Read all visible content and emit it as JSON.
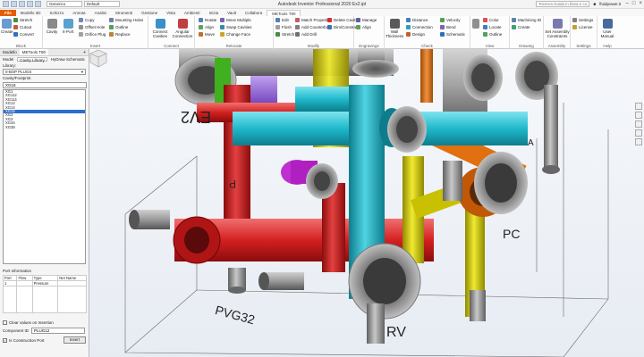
{
  "titlebar": {
    "app_title": "Autodesk Inventor Professional 2020   Ex2.ipt",
    "material": "Generico",
    "appearance": "Default",
    "search_placeholder": "Ricerca Guida in linea e comandi",
    "user": "lfuidpower.it"
  },
  "tabs": [
    "File",
    "Modello 3D",
    "Schizzo",
    "Annota",
    "Analisi",
    "Strumenti",
    "Gestione",
    "Vista",
    "Ambienti",
    "Inizia",
    "Vault",
    "Collabora",
    "METools T80"
  ],
  "active_tab": "METools T80",
  "ribbon": {
    "block": {
      "create": "Create",
      "stretch": "Stretch",
      "cutout": "Cutout",
      "convert": "Convert",
      "title": "Block"
    },
    "insert": {
      "cavity": "Cavity",
      "xport": "X-Port",
      "copy": "Copy",
      "offset_hole": "Offset Hole",
      "orifice_plug": "Orifice Plug",
      "mounting_holes": "Mounting Holes",
      "outline": "Outline",
      "replace": "Replace",
      "title": "Insert"
    },
    "connect": {
      "connect_cavities": "Connect Cavities",
      "angular_connection": "Angular Connection",
      "title": "Connect"
    },
    "relocate": {
      "rotate": "Rotate",
      "align": "Align",
      "move": "Move",
      "move_multiple": "Move Multiple",
      "swap_cavities": "Swap Cavities",
      "change_face": "Change Face",
      "title": "Relocate"
    },
    "modify": {
      "edit": "Edit",
      "flush": "Flush",
      "stretch": "Stretch",
      "match_properties": "Match Properties",
      "add_counterbore": "Add Counterbore",
      "add_drill": "Add Drill",
      "delete_cavity": "Delete Cavity",
      "dim_constrain": "Dim/Constrain",
      "title": "Modify"
    },
    "engravings": {
      "manage": "Manage",
      "align": "Align",
      "title": "Engravings"
    },
    "check": {
      "wall_thickness": "Wall Thickness",
      "distance": "Distance",
      "connection": "Connection",
      "design": "Design",
      "velocity": "Velocity",
      "bend": "Bend",
      "schematic": "Schematic",
      "title": "Check"
    },
    "view": {
      "color": "Color",
      "locate": "Locate",
      "outline": "Outline",
      "title": "View"
    },
    "drawing": {
      "machining_id": "Machining ID",
      "create": "Create",
      "title": "Drawing"
    },
    "assembly": {
      "set_assembly_constraints": "Set Assembly Constraints",
      "title": "Assembly"
    },
    "settings": {
      "settings": "Settings",
      "license": "License",
      "title": "Settings"
    },
    "help": {
      "user_manual": "User Manual",
      "title": "Help"
    }
  },
  "left_panel": {
    "tabs": [
      "Modello",
      "METools T80"
    ],
    "active_tab": "METools T80",
    "sub_tabs": [
      "Model",
      "Cavity Library",
      "HyDraw Schematic"
    ],
    "library_label": "Library:",
    "library_value": "0-BSP PLUGS",
    "cavity_label": "Cavity/Footprint",
    "search_value": "XG16",
    "items": [
      "XG1",
      "XG112",
      "XG114",
      "XG12",
      "XG14",
      "XG16",
      "XG2",
      "XG3",
      "XG34",
      "XG38"
    ],
    "selected_item": "XG16",
    "port_info_title": "Port Information",
    "port_table_headers": [
      "Port",
      "Flow",
      "Type",
      "Net Name"
    ],
    "port_table_row": [
      "1",
      "",
      "Pressure",
      ""
    ],
    "clear_values_label": "Clear values on Insertion",
    "component_id_label": "Component ID",
    "component_id_value": "PLUG12",
    "construction_port_label": "Is Construction Port",
    "insert_button": "Insert"
  },
  "viewport": {
    "labels": [
      "EV2",
      "PC",
      "PVG32",
      "RV",
      "P",
      "A"
    ],
    "colors": {
      "cyan": "#1fb9cc",
      "red": "#d42020",
      "yellow": "#d8d000",
      "orange": "#e07010",
      "purple": "#8a5cd8",
      "magenta": "#c030d0",
      "green": "#40b020",
      "gray": "#9a9a9a"
    }
  }
}
